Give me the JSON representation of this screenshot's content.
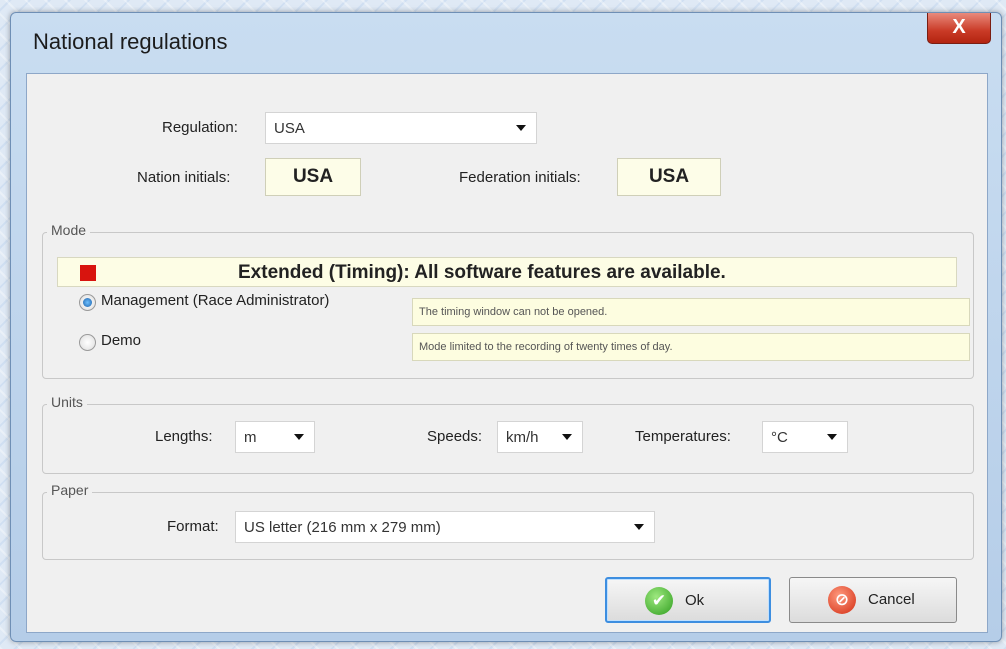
{
  "window": {
    "title": "National regulations",
    "close_glyph": "X"
  },
  "regulation": {
    "label": "Regulation:",
    "value": "USA"
  },
  "nation_initials": {
    "label": "Nation initials:",
    "value": "USA"
  },
  "federation_initials": {
    "label": "Federation initials:",
    "value": "USA"
  },
  "mode": {
    "legend": "Mode",
    "banner": "Extended (Timing): All software features are available.",
    "options": [
      {
        "label": "Management (Race Administrator)",
        "note": "The timing window can not be opened.",
        "selected": true
      },
      {
        "label": "Demo",
        "note": "Mode limited to the recording of twenty times of day.",
        "selected": false
      }
    ]
  },
  "units": {
    "legend": "Units",
    "lengths_label": "Lengths:",
    "lengths_value": "m",
    "speeds_label": "Speeds:",
    "speeds_value": "km/h",
    "temperatures_label": "Temperatures:",
    "temperatures_value": "°C"
  },
  "paper": {
    "legend": "Paper",
    "format_label": "Format:",
    "format_value": "US letter (216 mm x 279 mm)"
  },
  "buttons": {
    "ok_label": "Ok",
    "cancel_label": "Cancel"
  },
  "colors": {
    "banner_status": "#d8140e",
    "ok_icon": "#2f9e1f",
    "cancel_icon": "#d22c12"
  }
}
